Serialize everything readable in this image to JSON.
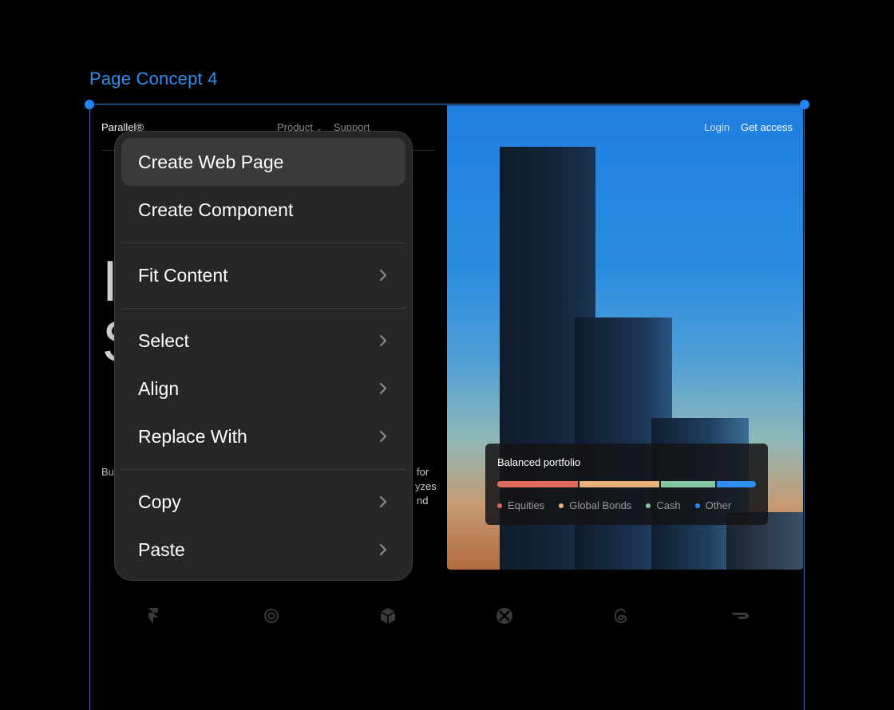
{
  "canvas": {
    "frame_label": "Page Concept 4"
  },
  "page": {
    "brand": "Parallel®",
    "nav": {
      "product": "Product",
      "support": "Support",
      "login": "Login",
      "get_access": "Get access"
    },
    "hero_fragments": [
      "I",
      "S"
    ],
    "body_fragments": {
      "left": "Bu",
      "right_1": "for",
      "right_2": "yzes",
      "right_3": "nd"
    },
    "portfolio_card": {
      "title": "Balanced portfolio",
      "segments": [
        {
          "name": "Equities",
          "share": 0.31,
          "color": "#e06a5c"
        },
        {
          "name": "Global Bonds",
          "share": 0.31,
          "color": "#e8b07a"
        },
        {
          "name": "Cash",
          "share": 0.21,
          "color": "#86c6a4"
        },
        {
          "name": "Other",
          "share": 0.15,
          "color": "#2f8ef0"
        }
      ]
    },
    "logos": [
      "framer-icon",
      "openai-icon",
      "box-icon",
      "xbox-icon",
      "threads-icon",
      "doordash-icon"
    ]
  },
  "context_menu": {
    "items": [
      {
        "label": "Create Web Page",
        "has_submenu": false,
        "active": true
      },
      {
        "label": "Create Component",
        "has_submenu": false,
        "active": false
      },
      {
        "label": "Fit Content",
        "has_submenu": true,
        "active": false
      },
      {
        "label": "Select",
        "has_submenu": true,
        "active": false
      },
      {
        "label": "Align",
        "has_submenu": true,
        "active": false
      },
      {
        "label": "Replace With",
        "has_submenu": true,
        "active": false
      },
      {
        "label": "Copy",
        "has_submenu": true,
        "active": false
      },
      {
        "label": "Paste",
        "has_submenu": true,
        "active": false
      }
    ]
  },
  "colors": {
    "accent": "#1e86f5",
    "menu_bg": "#262626",
    "menu_active": "#3a3a3a"
  }
}
